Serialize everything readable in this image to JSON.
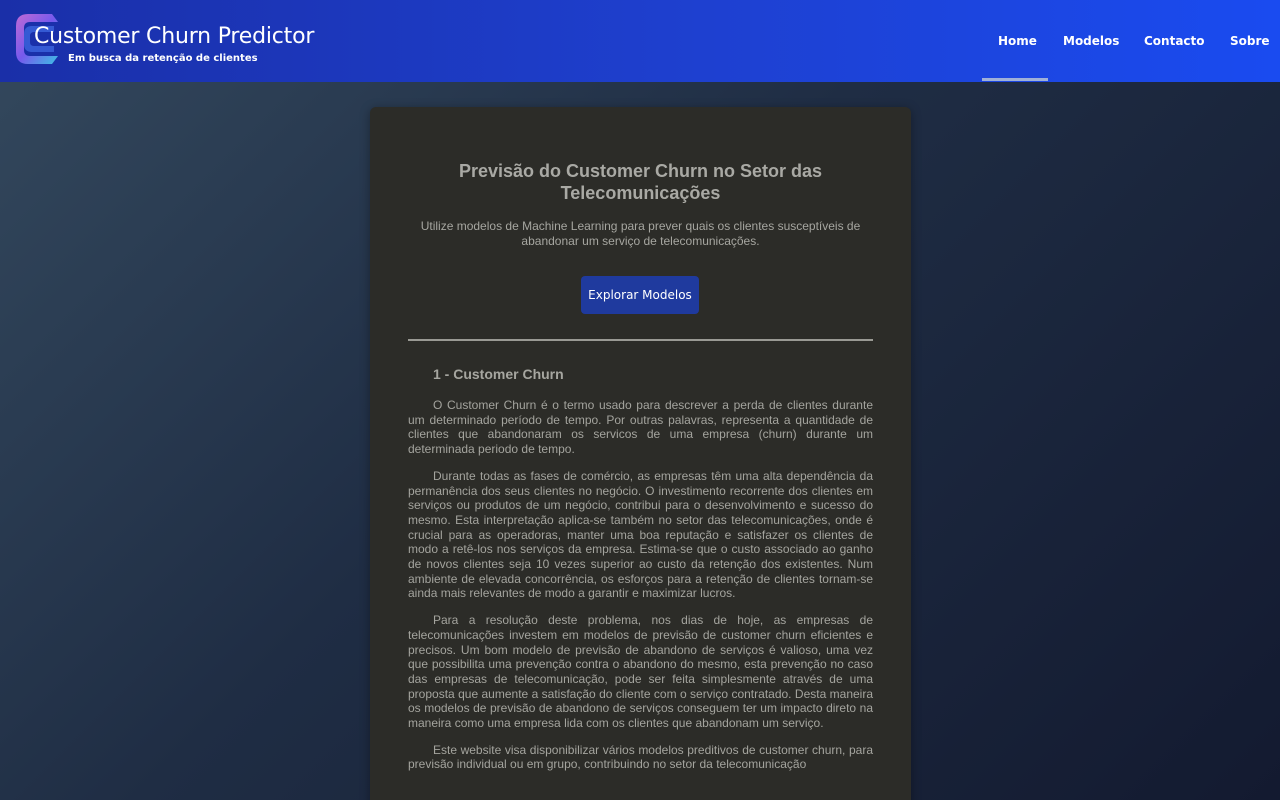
{
  "brand": {
    "title": "Customer Churn Predictor",
    "subtitle": "Em busca da retenção de clientes",
    "logo_icon": "c-letter-logo-icon"
  },
  "nav": {
    "items": [
      {
        "label": "Home",
        "active": true
      },
      {
        "label": "Modelos",
        "active": false
      },
      {
        "label": "Contacto",
        "active": false
      },
      {
        "label": "Sobre",
        "active": false
      }
    ]
  },
  "hero": {
    "title": "Previsão do Customer Churn no Setor das Telecomunicações",
    "intro": "Utilize modelos de Machine Learning para prever quais os clientes susceptíveis de abandonar um serviço de telecomunicações.",
    "button_label": "Explorar Modelos"
  },
  "article": {
    "section_title": "1 - Customer Churn",
    "paragraphs": [
      "O Customer Churn é o termo usado para descrever a perda de clientes durante um determinado período de tempo. Por outras palavras, representa a quantidade de clientes que abandonaram os servicos de uma empresa (churn) durante um determinada periodo de tempo.",
      "Durante todas as fases de comércio, as empresas têm uma alta dependência da permanência dos seus clientes no negócio. O investimento recorrente dos clientes em serviços ou produtos de um negócio, contribui para o desenvolvimento e sucesso do mesmo. Esta interpretação aplica-se também no setor das telecomunicações, onde é crucial para as operadoras, manter uma boa reputação e satisfazer os clientes de modo a retê-los nos serviços da empresa. Estima-se que o custo associado ao ganho de novos clientes seja 10 vezes superior ao custo da retenção dos existentes. Num ambiente de elevada concorrência, os esforços para a retenção de clientes tornam-se ainda mais relevantes de modo a garantir e maximizar lucros.",
      "Para a resolução deste problema, nos dias de hoje, as empresas de telecomunicações investem em modelos de previsão de customer churn eficientes e precisos. Um bom modelo de previsão de abandono de serviços é valioso, uma vez que possibilita uma prevenção contra o abandono do mesmo, esta prevenção no caso das empresas de telecomunicação, pode ser feita simplesmente através de uma proposta que aumente a satisfação do cliente com o serviço contratado. Desta maneira os modelos de previsão de abandono de serviços conseguem ter um impacto direto na maneira como uma empresa lida com os clientes que abandonam um serviço.",
      "Este website visa disponibilizar vários modelos preditivos de customer churn, para previsão individual ou em grupo, contribuindo no setor da telecomunicação"
    ]
  },
  "colors": {
    "navbar": "#1e40d0",
    "button": "#1f3a9e",
    "card": "#2c2c28"
  }
}
